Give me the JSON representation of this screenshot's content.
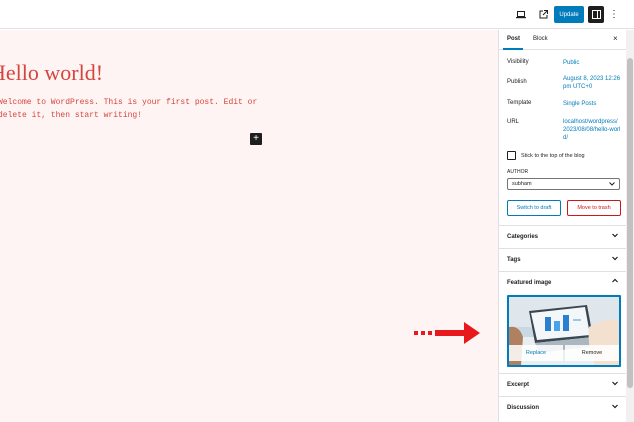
{
  "topbar": {
    "update_label": "Update",
    "more_label": "⋮"
  },
  "editor": {
    "title": "Hello world!",
    "body": "Welcome to WordPress. This is your first post. Edit or delete it, then start writing!",
    "inserter_label": "+"
  },
  "sidebar": {
    "tabs": [
      {
        "label": "Post"
      },
      {
        "label": "Block"
      }
    ],
    "close_label": "×",
    "rows": [
      {
        "label": "Visibility",
        "value": "Public"
      },
      {
        "label": "Publish",
        "value": "August 8, 2023 12:26 pm UTC+0"
      },
      {
        "label": "Template",
        "value": "Single Posts"
      },
      {
        "label": "URL",
        "value": "localhost/wordpress/2023/08/08/hello-world/"
      }
    ],
    "sticky_label": "Stick to the top of the blog",
    "author_label": "AUTHOR",
    "author_value": "subham",
    "switch_draft_label": "Switch to draft",
    "move_trash_label": "Move to trash",
    "panels": [
      {
        "title": "Categories",
        "expanded": false
      },
      {
        "title": "Tags",
        "expanded": false
      },
      {
        "title": "Featured image",
        "expanded": true
      },
      {
        "title": "Excerpt",
        "expanded": false
      },
      {
        "title": "Discussion",
        "expanded": false
      }
    ],
    "featured_image": {
      "replace_label": "Replace",
      "remove_label": "Remove"
    }
  },
  "colors": {
    "accent": "#007cba",
    "danger": "#cc1818",
    "editor_bg": "#fff4f4",
    "title_color": "#d6453d",
    "arrow": "#e8191c"
  }
}
